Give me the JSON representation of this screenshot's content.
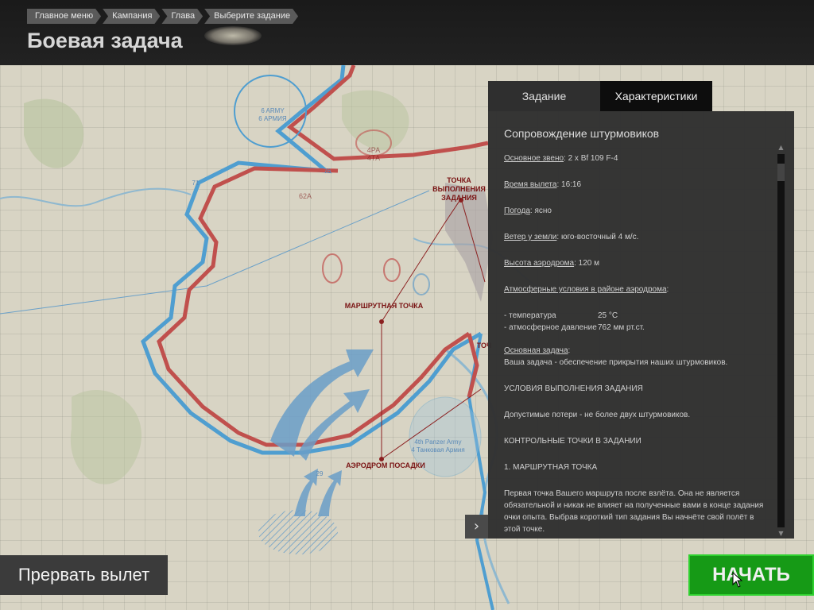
{
  "breadcrumb": [
    "Главное меню",
    "Кампания",
    "Глава",
    "Выберите задание"
  ],
  "page_title": "Боевая задача",
  "tabs": {
    "mission": "Задание",
    "characteristics": "Характеристики"
  },
  "briefing": {
    "title": "Сопровождение штурмовиков",
    "fields": [
      {
        "label": "Основное звено",
        "value": ": 2 x Bf 109 F-4"
      },
      {
        "label": "Время вылета",
        "value": ": 16:16"
      },
      {
        "label": "Погода",
        "value": ": ясно"
      },
      {
        "label": "Ветер у земли",
        "value": ": юго-восточный 4 м/с."
      },
      {
        "label": "Высота аэродрома",
        "value": ": 120 м"
      },
      {
        "label": "Атмосферные условия в районе аэродрома",
        "value": ":"
      }
    ],
    "atmo": [
      {
        "label": "- температура",
        "value": "25 °C"
      },
      {
        "label": "- атмосферное давление",
        "value": "762 мм рт.ст."
      }
    ],
    "main_task_label": "Основная задача",
    "main_task_colon": ":",
    "main_task_text": "Ваша задача - обеспечение прикрытия наших штурмовиков.",
    "conditions_heading": "УСЛОВИЯ ВЫПОЛНЕНИЯ ЗАДАНИЯ",
    "conditions_text": "Допустимые потери - не более двух штурмовиков.",
    "checkpoints_heading": "КОНТРОЛЬНЫЕ ТОЧКИ В ЗАДАНИИ",
    "checkpoint1_heading": "1. МАРШРУТНАЯ ТОЧКА",
    "checkpoint1_text": "Первая точка Вашего маршрута после взлёта. Она не является обязательной и никак не влияет на полученные вами в конце задания очки опыта. Выбрав короткий тип задания Вы начнёте свой полёт в этой точке."
  },
  "map_labels": {
    "target_point": "ТОЧКА ВЫПОЛНЕНИЯ ЗАДАНИЯ",
    "waypoint": "МАРШРУТНАЯ ТОЧКА",
    "landing_airfield": "АЭРОДРОМ ПОСАДКИ",
    "cut_off": "ТОЧ",
    "army6_en": "6 ARMY",
    "army6_ru": "6 АРМИЯ",
    "panzer4_en": "4th Panzer Army",
    "panzer4_ru": "4 Танковая Армия",
    "unit_4pa": "4РА",
    "unit_4ta": "4ТА",
    "unit_62a": "62А",
    "unit_76": "76",
    "unit_71": "71",
    "unit_29": "29"
  },
  "buttons": {
    "abort": "Прервать вылет",
    "start": "НАЧАТЬ",
    "collapse": "›"
  },
  "colors": {
    "start_green": "#169a16",
    "front_red": "#c0504d",
    "front_blue": "#4f9ed0",
    "map_bg": "#d8d4c4"
  }
}
